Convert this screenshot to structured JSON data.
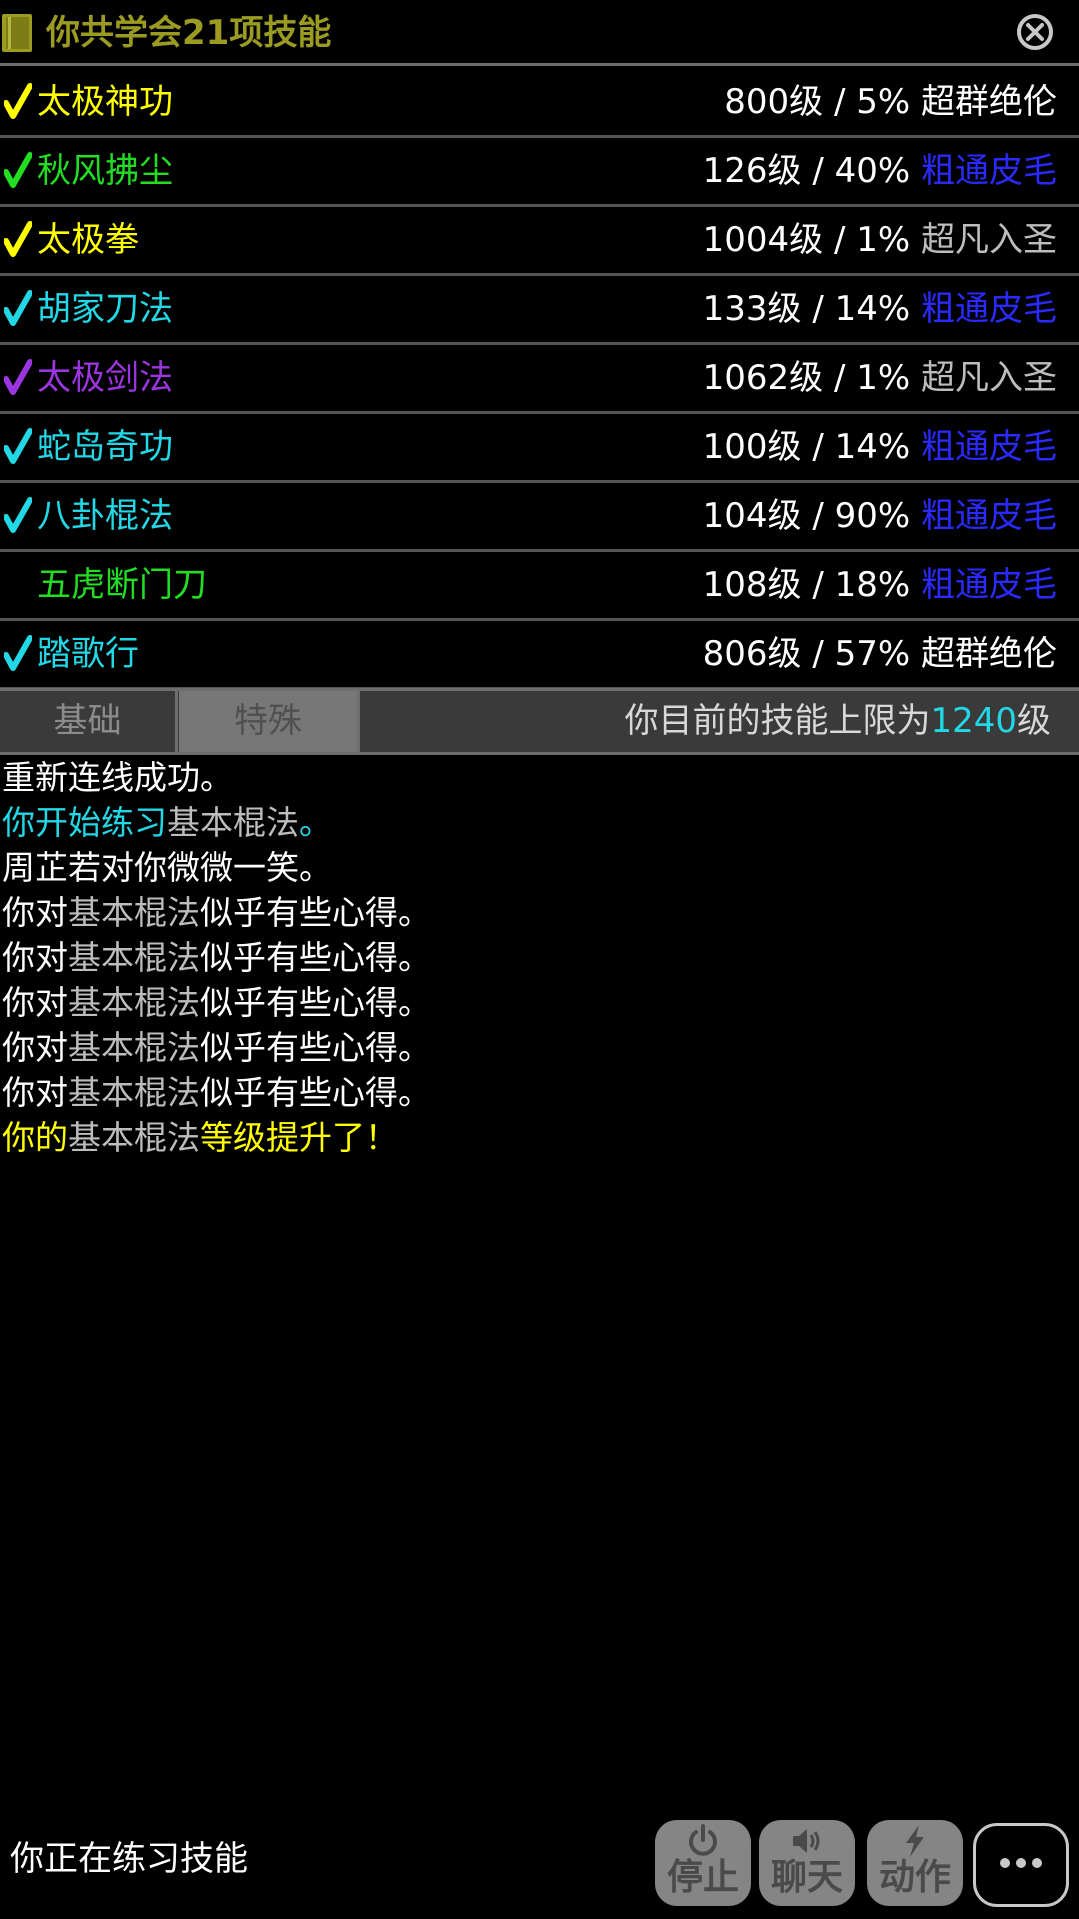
{
  "header": {
    "title": "你共学会21项技能",
    "title_color": "#9b9b22"
  },
  "skills": [
    {
      "name": "太极神功",
      "checked": true,
      "check_color": "#ffff00",
      "name_color": "#ffff00",
      "info": "800级 / 5% ",
      "rank": "超群绝伦",
      "rank_color": "#ffffff"
    },
    {
      "name": "秋风拂尘",
      "checked": true,
      "check_color": "#22dd22",
      "name_color": "#22dd22",
      "info": "126级 / 40% ",
      "rank": "粗通皮毛",
      "rank_color": "#2a2aff"
    },
    {
      "name": "太极拳",
      "checked": true,
      "check_color": "#ffff00",
      "name_color": "#ffff00",
      "info": "1004级 / 1% ",
      "rank": "超凡入圣",
      "rank_color": "#bdbdbd"
    },
    {
      "name": "胡家刀法",
      "checked": true,
      "check_color": "#22d8e6",
      "name_color": "#22d8e6",
      "info": "133级 / 14% ",
      "rank": "粗通皮毛",
      "rank_color": "#2a2aff"
    },
    {
      "name": "太极剑法",
      "checked": true,
      "check_color": "#9b35e0",
      "name_color": "#9b35e0",
      "info": "1062级 / 1% ",
      "rank": "超凡入圣",
      "rank_color": "#bdbdbd"
    },
    {
      "name": "蛇岛奇功",
      "checked": true,
      "check_color": "#22d8e6",
      "name_color": "#22d8e6",
      "info": "100级 / 14% ",
      "rank": "粗通皮毛",
      "rank_color": "#2a2aff"
    },
    {
      "name": "八卦棍法",
      "checked": true,
      "check_color": "#22d8e6",
      "name_color": "#22d8e6",
      "info": "104级 / 90% ",
      "rank": "粗通皮毛",
      "rank_color": "#2a2aff"
    },
    {
      "name": "五虎断门刀",
      "checked": false,
      "check_color": "#22dd22",
      "name_color": "#22dd22",
      "info": "108级 / 18% ",
      "rank": "粗通皮毛",
      "rank_color": "#2a2aff"
    },
    {
      "name": "踏歌行",
      "checked": true,
      "check_color": "#22d8e6",
      "name_color": "#22d8e6",
      "info": "806级 / 57% ",
      "rank": "超群绝伦",
      "rank_color": "#ffffff"
    }
  ],
  "tabs": {
    "basic": "基础",
    "special": "特殊",
    "active": "special"
  },
  "limit": {
    "prefix": "你目前的技能上限为",
    "value": "1240",
    "suffix": "级",
    "value_color": "#22d8e6"
  },
  "log": [
    [
      {
        "t": "重新连线成功。",
        "c": "#ffffff"
      }
    ],
    [
      {
        "t": "你开始练习",
        "c": "#22d8e6"
      },
      {
        "t": "基本棍法",
        "c": "#bdbdbd"
      },
      {
        "t": "。",
        "c": "#22d8e6"
      }
    ],
    [
      {
        "t": "周芷若对你微微一笑。",
        "c": "#ffffff"
      }
    ],
    [
      {
        "t": "你对",
        "c": "#ffffff"
      },
      {
        "t": "基本棍法",
        "c": "#bdbdbd"
      },
      {
        "t": "似乎有些心得。",
        "c": "#ffffff"
      }
    ],
    [
      {
        "t": "你对",
        "c": "#ffffff"
      },
      {
        "t": "基本棍法",
        "c": "#bdbdbd"
      },
      {
        "t": "似乎有些心得。",
        "c": "#ffffff"
      }
    ],
    [
      {
        "t": "你对",
        "c": "#ffffff"
      },
      {
        "t": "基本棍法",
        "c": "#bdbdbd"
      },
      {
        "t": "似乎有些心得。",
        "c": "#ffffff"
      }
    ],
    [
      {
        "t": "你对",
        "c": "#ffffff"
      },
      {
        "t": "基本棍法",
        "c": "#bdbdbd"
      },
      {
        "t": "似乎有些心得。",
        "c": "#ffffff"
      }
    ],
    [
      {
        "t": "你对",
        "c": "#ffffff"
      },
      {
        "t": "基本棍法",
        "c": "#bdbdbd"
      },
      {
        "t": "似乎有些心得。",
        "c": "#ffffff"
      }
    ],
    [
      {
        "t": "你的",
        "c": "#ffff00"
      },
      {
        "t": "基本棍法",
        "c": "#bdbdbd"
      },
      {
        "t": "等级提升了！",
        "c": "#ffff00"
      }
    ]
  ],
  "status": {
    "text": "你正在练习技能"
  },
  "actions": {
    "stop": {
      "label": "停止",
      "icon": "power-icon"
    },
    "chat": {
      "label": "聊天",
      "icon": "speaker-icon"
    },
    "action": {
      "label": "动作",
      "icon": "lightning-icon"
    },
    "more": {
      "icon": "more-dots-icon"
    }
  }
}
